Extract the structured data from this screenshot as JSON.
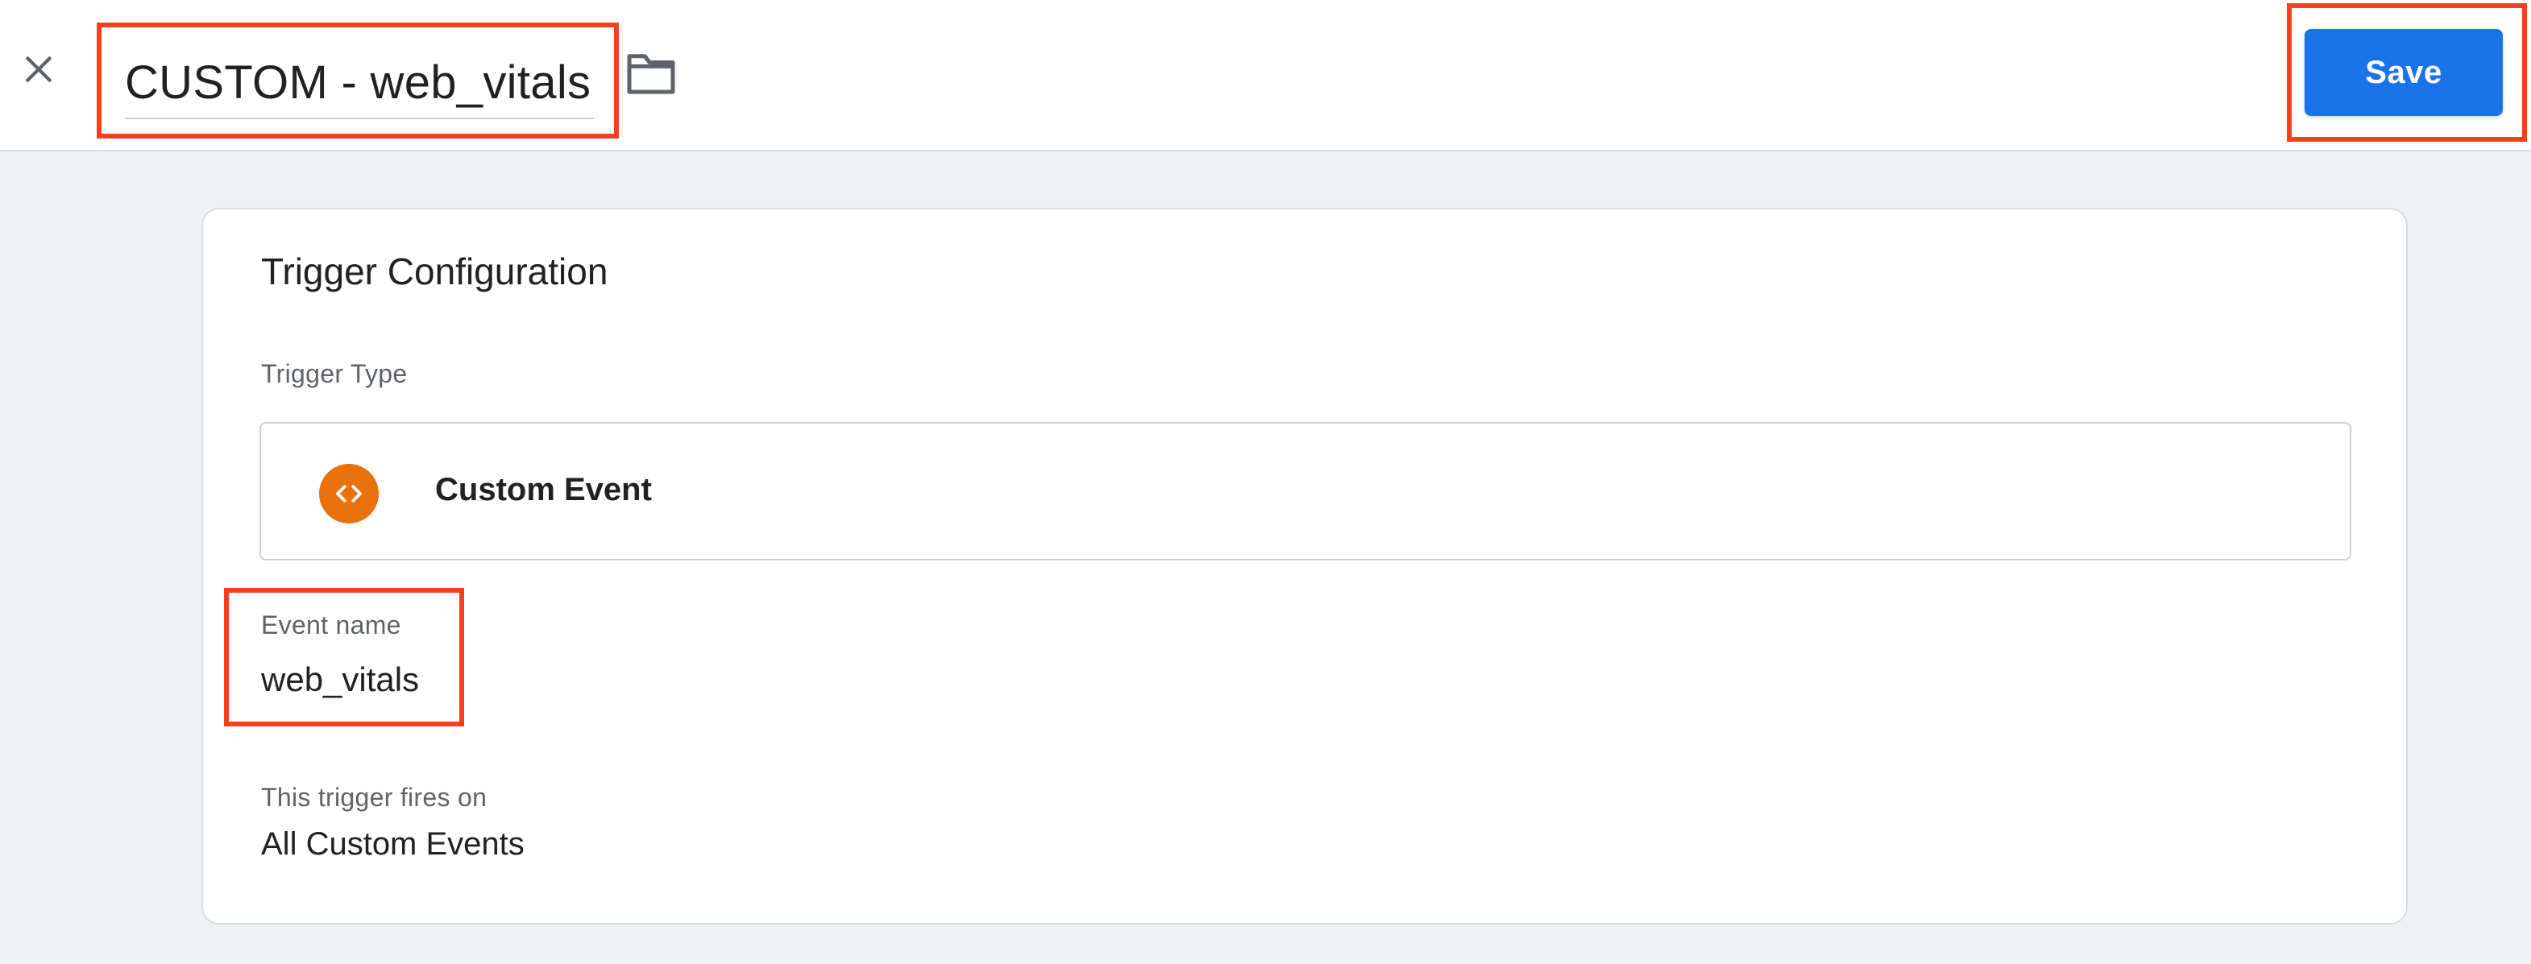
{
  "header": {
    "title": "CUSTOM - web_vitals",
    "save_label": "Save",
    "close_icon": "close-icon",
    "folder_icon": "folder-icon"
  },
  "card": {
    "title": "Trigger Configuration",
    "trigger_type_label": "Trigger Type",
    "trigger_type": {
      "name": "Custom Event",
      "icon": "code-brackets-icon",
      "icon_color": "#e8710a"
    },
    "event_name_label": "Event name",
    "event_name_value": "web_vitals",
    "fires_on_label": "This trigger fires on",
    "fires_on_value": "All Custom Events"
  },
  "colors": {
    "accent": "#1a73e8",
    "highlight": "#f4411c",
    "page_background": "#eef2f3"
  }
}
